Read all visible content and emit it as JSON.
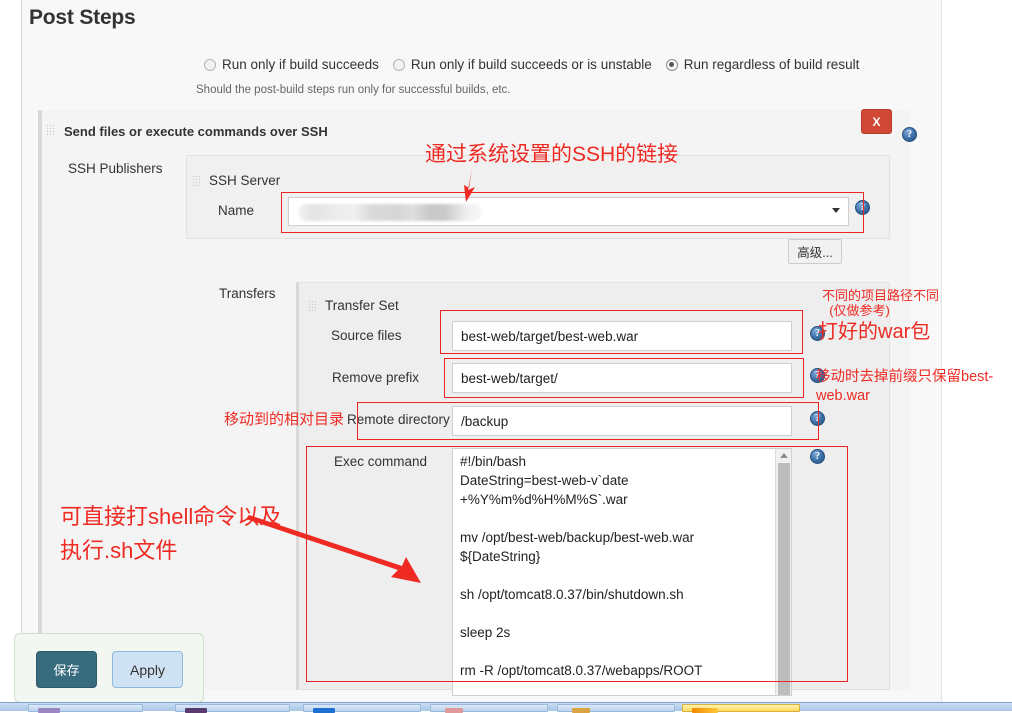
{
  "page": {
    "title": "Post Steps"
  },
  "run_condition": {
    "options": [
      {
        "label": "Run only if build succeeds",
        "checked": false
      },
      {
        "label": "Run only if build succeeds or is unstable",
        "checked": false
      },
      {
        "label": "Run regardless of build result",
        "checked": true
      }
    ],
    "help_text": "Should the post-build steps run only for successful builds, etc."
  },
  "plugin": {
    "title": "Send files or execute commands over SSH",
    "close_label": "X",
    "publishers_label": "SSH Publishers",
    "help_icon": "help-icon"
  },
  "ssh_server": {
    "section_title": "SSH Server",
    "name_label": "Name",
    "name_value": "",
    "name_redacted": true,
    "dropdown_icon": "chevron-down-icon",
    "advanced_button": "高级..."
  },
  "transfers": {
    "label": "Transfers",
    "set_title": "Transfer Set",
    "fields": [
      {
        "label": "Source files",
        "value": "best-web/target/best-web.war"
      },
      {
        "label": "Remove prefix",
        "value": "best-web/target/"
      },
      {
        "label": "Remote directory",
        "value": "/backup"
      }
    ],
    "exec_label": "Exec command",
    "exec_value": "#!/bin/bash\nDateString=best-web-v`date\n+%Y%m%d%H%M%S`.war\n\nmv /opt/best-web/backup/best-web.war\n${DateString}\n\nsh /opt/tomcat8.0.37/bin/shutdown.sh\n\nsleep 2s\n\nrm -R /opt/tomcat8.0.37/webapps/ROOT"
  },
  "annotations": {
    "ssh_link": "通过系统设置的SSH的链接",
    "project_path": "不同的项目路径不同\n  (仅做参考)",
    "war_package": "打好的war包",
    "remove_prefix": "移动时去掉前缀只保留best-web.war",
    "relative_dir": "移动到的相对目录",
    "shell_command": "可直接打shell命令以及\n执行.sh文件",
    "color": "#ee2a23"
  },
  "footer": {
    "save_label": "保存",
    "apply_label": "Apply"
  },
  "taskbar": {
    "items": [
      "task-1",
      "task-2",
      "task-3",
      "task-4",
      "task-5",
      "task-6"
    ]
  }
}
